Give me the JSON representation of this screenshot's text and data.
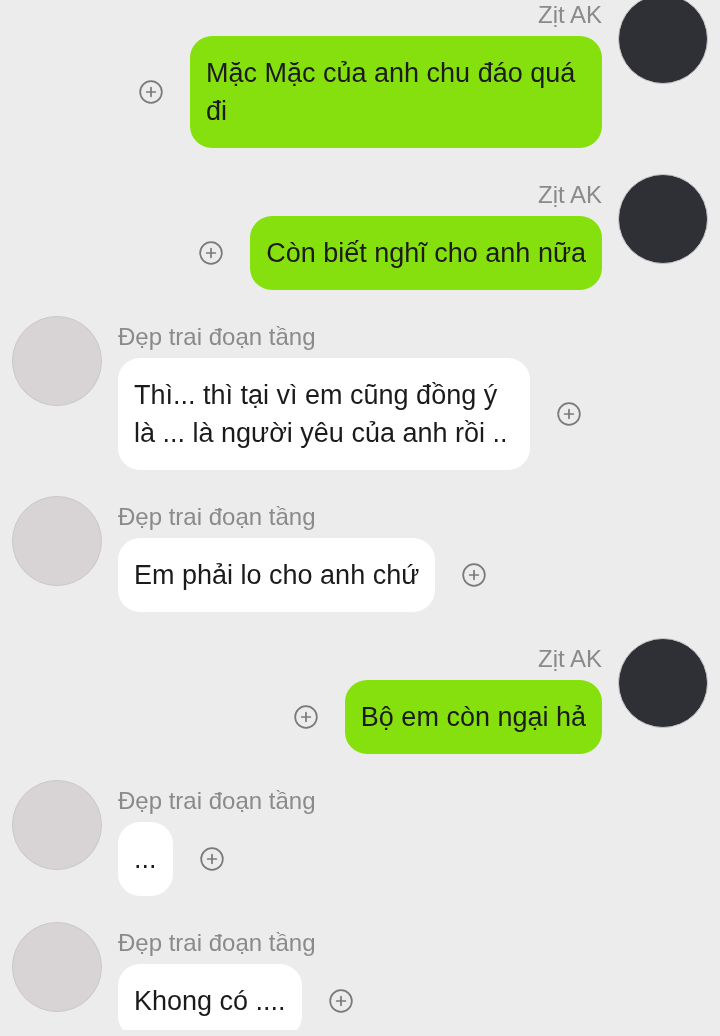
{
  "messages": [
    {
      "kind": "sent",
      "sender": "Zịt AK",
      "text": "Mặc Mặc của anh chu đáo quá đi"
    },
    {
      "kind": "sent",
      "sender": "Zịt AK",
      "text": "Còn biết nghĩ cho anh nữa"
    },
    {
      "kind": "received",
      "sender": "Đẹp trai đoạn tầng",
      "text": "Thì... thì tại vì em cũng đồng ý là ... là người yêu của anh rồi .."
    },
    {
      "kind": "received",
      "sender": "Đẹp trai đoạn tầng",
      "text": "Em phải lo cho anh chứ"
    },
    {
      "kind": "sent",
      "sender": "Zịt AK",
      "text": "Bộ em còn ngại hả"
    },
    {
      "kind": "received",
      "sender": "Đẹp trai đoạn tầng",
      "text": "..."
    },
    {
      "kind": "received",
      "sender": "Đẹp trai đoạn tầng",
      "text": "Khong có ...."
    }
  ]
}
